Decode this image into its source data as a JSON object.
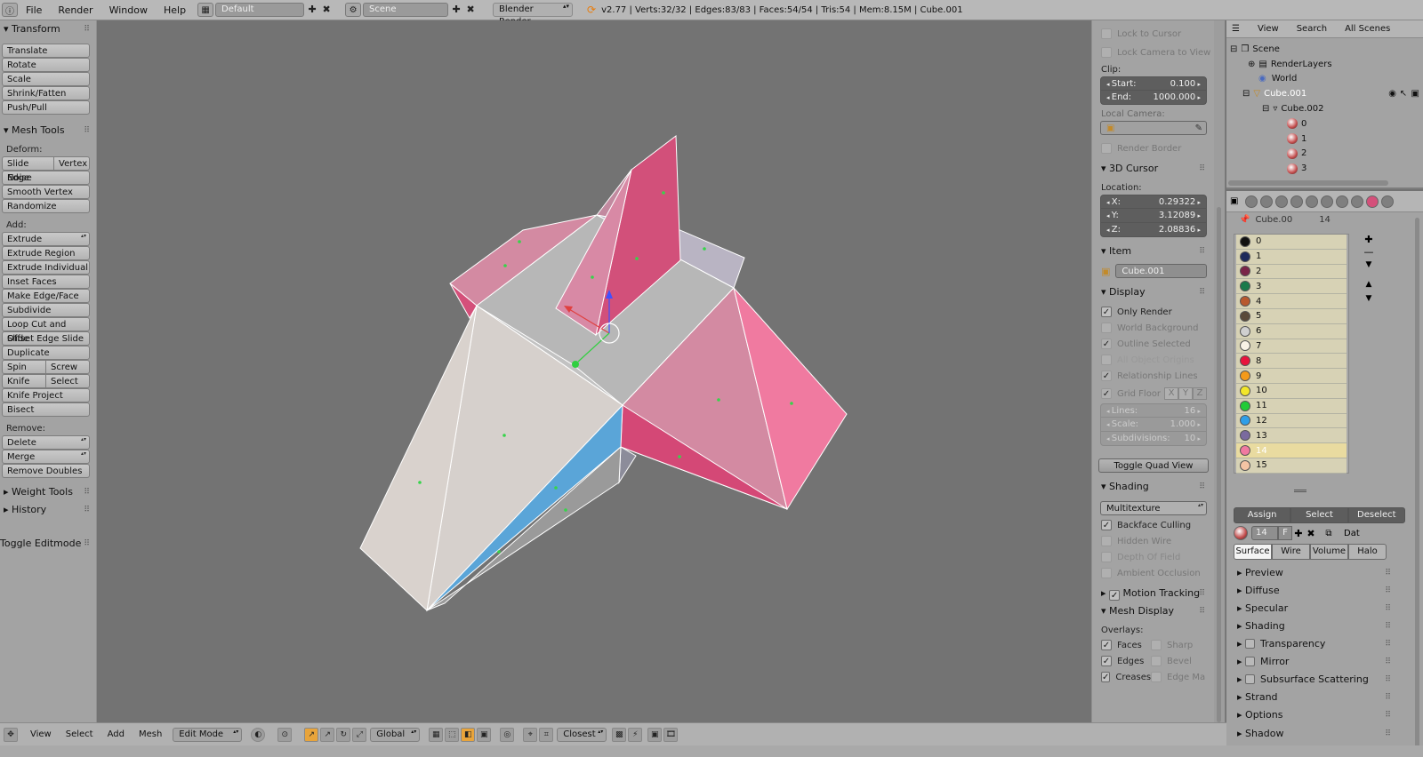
{
  "topbar": {
    "menus": [
      "File",
      "Render",
      "Window",
      "Help"
    ],
    "layout": "Default",
    "scene": "Scene",
    "engine": "Blender Render",
    "info": "v2.77 | Verts:32/32 | Edges:83/83 | Faces:54/54 | Tris:54 | Mem:8.15M | Cube.001"
  },
  "toolshelf": {
    "transform_title": "Transform",
    "transform": [
      "Translate",
      "Rotate",
      "Scale",
      "Shrink/Fatten",
      "Push/Pull"
    ],
    "mesh_tools_title": "Mesh Tools",
    "deform_label": "Deform:",
    "slide_edge": "Slide Edge",
    "vertex": "Vertex",
    "noise": "Noise",
    "smooth_vertex": "Smooth Vertex",
    "randomize": "Randomize",
    "add_label": "Add:",
    "extrude": "Extrude",
    "extrude_region": "Extrude Region",
    "extrude_individual": "Extrude Individual",
    "inset_faces": "Inset Faces",
    "make_edge_face": "Make Edge/Face",
    "subdivide": "Subdivide",
    "loop_cut": "Loop Cut and Slide",
    "offset_edge": "Offset Edge Slide",
    "duplicate": "Duplicate",
    "spin": "Spin",
    "screw": "Screw",
    "knife": "Knife",
    "select": "Select",
    "knife_project": "Knife Project",
    "bisect": "Bisect",
    "remove_label": "Remove:",
    "delete": "Delete",
    "merge": "Merge",
    "remove_doubles": "Remove Doubles",
    "weight_tools": "Weight Tools",
    "history": "History",
    "toggle_editmode": "Toggle Editmode"
  },
  "npanel": {
    "lock_cursor": "Lock to Cursor",
    "lock_camera": "Lock Camera to View",
    "clip_label": "Clip:",
    "clip_start_label": "Start:",
    "clip_start": "0.100",
    "clip_end_label": "End:",
    "clip_end": "1000.000",
    "local_camera": "Local Camera:",
    "render_border": "Render Border",
    "cursor_title": "3D Cursor",
    "location_label": "Location:",
    "x_label": "X:",
    "x": "0.29322",
    "y_label": "Y:",
    "y": "3.12089",
    "z_label": "Z:",
    "z": "2.08836",
    "item_title": "Item",
    "item_name": "Cube.001",
    "display_title": "Display",
    "only_render": "Only Render",
    "world_bg": "World Background",
    "outline_selected": "Outline Selected",
    "all_origins": "All Object Origins",
    "relationship_lines": "Relationship Lines",
    "grid_floor": "Grid Floor",
    "gx": "X",
    "gy": "Y",
    "gz": "Z",
    "lines_label": "Lines:",
    "lines": "16",
    "scale_label": "Scale:",
    "scale": "1.000",
    "subdiv_label": "Subdivisions:",
    "subdiv": "10",
    "toggle_quad": "Toggle Quad View",
    "shading_title": "Shading",
    "shading_mode": "Multitexture",
    "backface": "Backface Culling",
    "hidden_wire": "Hidden Wire",
    "dof": "Depth Of Field",
    "ao": "Ambient Occlusion",
    "motion_tracking": "Motion Tracking",
    "mesh_display": "Mesh Display",
    "overlays_label": "Overlays:",
    "faces": "Faces",
    "sharp": "Sharp",
    "edges": "Edges",
    "bevel": "Bevel",
    "creases": "Creases",
    "edge_ma": "Edge Ma"
  },
  "outliner": {
    "view": "View",
    "search": "Search",
    "all_scenes": "All Scenes",
    "rows": [
      "Scene",
      "RenderLayers",
      "World",
      "Cube.001",
      "Cube.002",
      "0",
      "1",
      "2",
      "3"
    ]
  },
  "props": {
    "obj": "Cube.00",
    "slot_count": "14",
    "slots": [
      "0",
      "1",
      "2",
      "3",
      "4",
      "5",
      "6",
      "7",
      "8",
      "9",
      "10",
      "11",
      "12",
      "13",
      "14",
      "15"
    ],
    "slot_colors": [
      "#111111",
      "#1e2a5a",
      "#7a2548",
      "#1a7a4a",
      "#b8582e",
      "#5a4a3a",
      "#cfcfcf",
      "#f8f2e6",
      "#e8143c",
      "#f49a1a",
      "#f2e62a",
      "#22cc36",
      "#2f9fe8",
      "#7a6a9e",
      "#f07aa0",
      "#f4c4a4"
    ],
    "assign": "Assign",
    "select": "Select",
    "deselect": "Deselect",
    "mat_num": "14",
    "mat_f": "F",
    "dat": "Dat",
    "tabs": [
      "Surface",
      "Wire",
      "Volume",
      "Halo"
    ],
    "sections": [
      "Preview",
      "Diffuse",
      "Specular",
      "Shading",
      "Transparency",
      "Mirror",
      "Subsurface Scattering",
      "Strand",
      "Options",
      "Shadow"
    ]
  },
  "bottombar": {
    "view": "View",
    "select": "Select",
    "add": "Add",
    "mesh": "Mesh",
    "mode": "Edit Mode",
    "orientation": "Global",
    "snap": "Closest"
  }
}
